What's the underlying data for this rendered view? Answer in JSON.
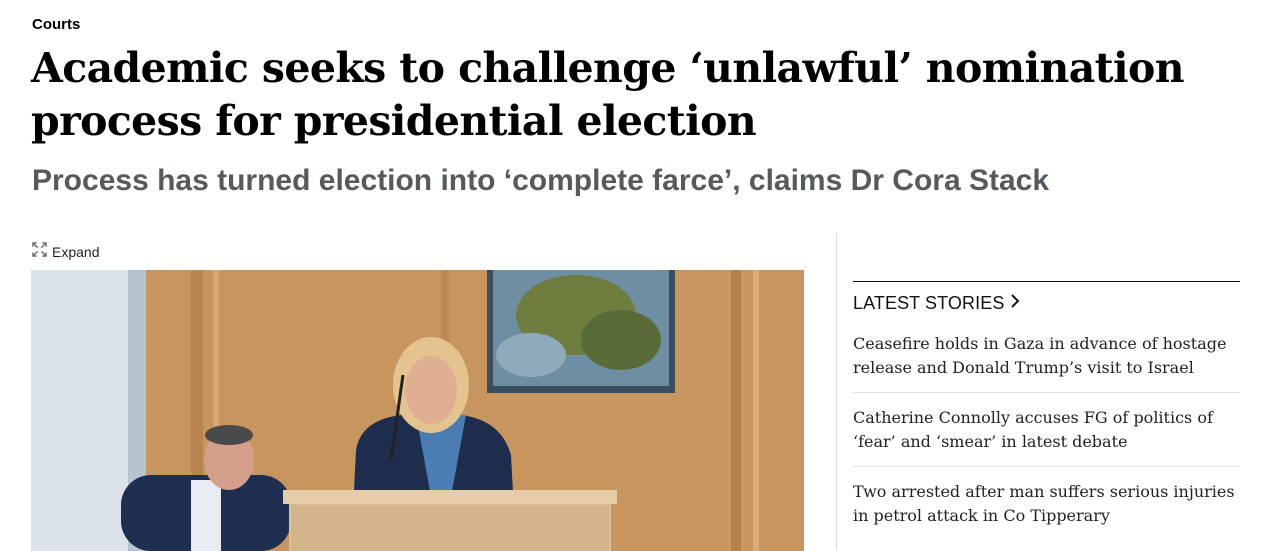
{
  "article": {
    "section": "Courts",
    "headline": "Academic seeks to challenge ‘unlawful’ nomination process for presidential election",
    "subheadline": "Process has turned election into ‘complete farce’, claims Dr Cora Stack",
    "expand_label": "Expand",
    "expand_icon": "expand-arrows-icon"
  },
  "sidebar": {
    "title": "LATEST STORIES",
    "title_icon": "chevron-right-icon",
    "stories": [
      "Ceasefire holds in Gaza in advance of hostage release and Donald Trump’s visit to Israel",
      "Catherine Connolly accuses FG of politics of ‘fear’ and ‘smear’ in latest debate",
      "Two arrested after man suffers serious injuries in petrol attack in Co Tipperary"
    ]
  },
  "colors": {
    "subheadline": "#555a5e",
    "divider": "#dcdcdc",
    "wood_panel": "#c7935c"
  }
}
